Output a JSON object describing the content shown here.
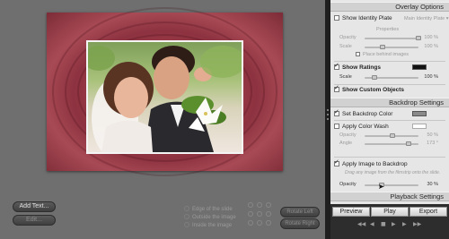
{
  "editor": {
    "add_text_label": "Add Text...",
    "edit_label": "Edit...",
    "layout_options": [
      "Edge of the slide",
      "Outside the image",
      "Inside the image"
    ],
    "rotate_left_label": "Rotate Left",
    "rotate_right_label": "Rotate Right"
  },
  "panel": {
    "overlay_options_title": "Overlay Options",
    "show_identity_plate": {
      "label": "Show Identity Plate",
      "checked": false,
      "dropdown": "Main Identity Plate"
    },
    "properties_label": "Properties",
    "opacity_label": "Opacity",
    "opacity_value": "100 %",
    "scale_label": "Scale",
    "scale_value": "100 %",
    "place_behind_images_label": "Place behind images",
    "show_ratings": {
      "label": "Show Ratings",
      "checked": true,
      "color": "#111111"
    },
    "ratings_scale_label": "Scale",
    "ratings_scale_value": "100 %",
    "show_custom_objects": {
      "label": "Show Custom Objects",
      "checked": true
    },
    "backdrop_settings_title": "Backdrop Settings",
    "set_backdrop_color": {
      "label": "Set Backdrop Color",
      "checked": true,
      "color": "#8a8a8a"
    },
    "apply_color_wash": {
      "label": "Apply Color Wash",
      "checked": false,
      "color": "#ffffff"
    },
    "wash_opacity_label": "Opacity",
    "wash_opacity_value": "50 %",
    "wash_angle_label": "Angle",
    "wash_angle_value": "173 °",
    "apply_image_to_backdrop": {
      "label": "Apply Image to Backdrop",
      "checked": true
    },
    "drag_hint": "Drag any image from the filmstrip onto the slide.",
    "image_opacity_label": "Opacity",
    "image_opacity_value": "30 %",
    "image_opacity_fraction": 0.3,
    "playback_settings_title": "Playback Settings"
  },
  "bottom": {
    "preview_label": "Preview",
    "play_label": "Play",
    "export_label": "Export",
    "transport_icons": [
      "first-icon",
      "previous-icon",
      "stop-icon",
      "play-icon",
      "next-icon",
      "last-icon"
    ]
  }
}
